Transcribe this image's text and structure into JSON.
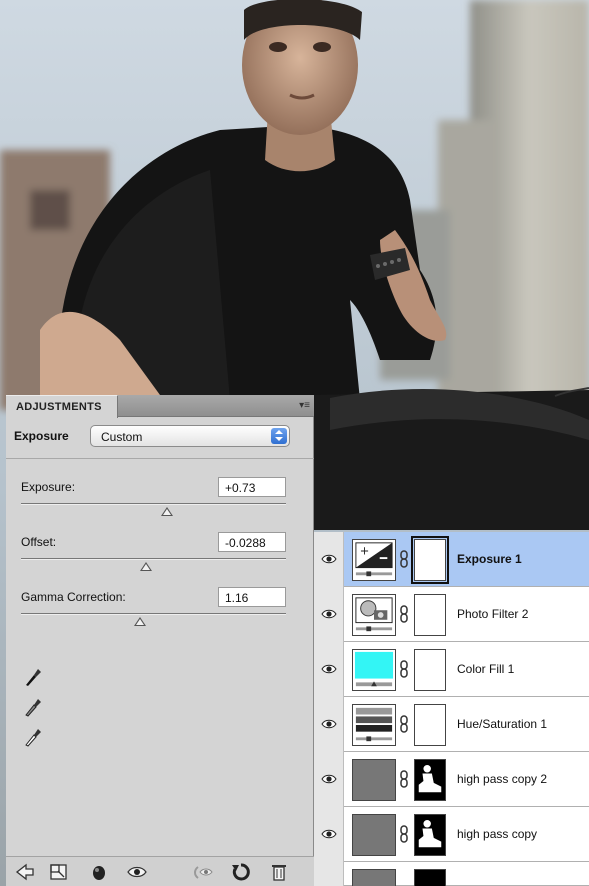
{
  "adjustments": {
    "tab_title": "ADJUSTMENTS",
    "panel_menu_icon": "panel-menu-icon",
    "preset_label": "Exposure",
    "preset_value": "Custom",
    "params": [
      {
        "label": "Exposure:",
        "value": "+0.73",
        "slider_fraction": 0.55
      },
      {
        "label": "Offset:",
        "value": "-0.0288",
        "slider_fraction": 0.47
      },
      {
        "label": "Gamma Correction:",
        "value": "1.16",
        "slider_fraction": 0.45
      }
    ],
    "eyedroppers": [
      "black-point-eyedropper-icon",
      "gray-point-eyedropper-icon",
      "white-point-eyedropper-icon"
    ],
    "footer_icons": [
      "back-arrow-icon",
      "expand-view-icon",
      "clip-to-layer-icon",
      "toggle-visibility-icon",
      "view-previous-icon",
      "reset-icon",
      "trash-icon"
    ]
  },
  "layers": [
    {
      "name": "Exposure 1",
      "thumb": "exposure-icon",
      "selected": true
    },
    {
      "name": "Photo Filter 2",
      "thumb": "photo-filter-icon",
      "selected": false
    },
    {
      "name": "Color Fill 1",
      "thumb": "color-fill-swatch",
      "fill_color": "#33f5f5",
      "selected": false
    },
    {
      "name": "Hue/Saturation 1",
      "thumb": "hue-saturation-icon",
      "selected": false
    },
    {
      "name": "high pass copy 2",
      "thumb": "gray-layer",
      "selected": false
    },
    {
      "name": "high pass copy",
      "thumb": "gray-layer",
      "selected": false
    }
  ],
  "colors": {
    "selection": "#aac8f3",
    "panel_bg": "#d4d4d4",
    "fill_cyan": "#33f5f5"
  }
}
